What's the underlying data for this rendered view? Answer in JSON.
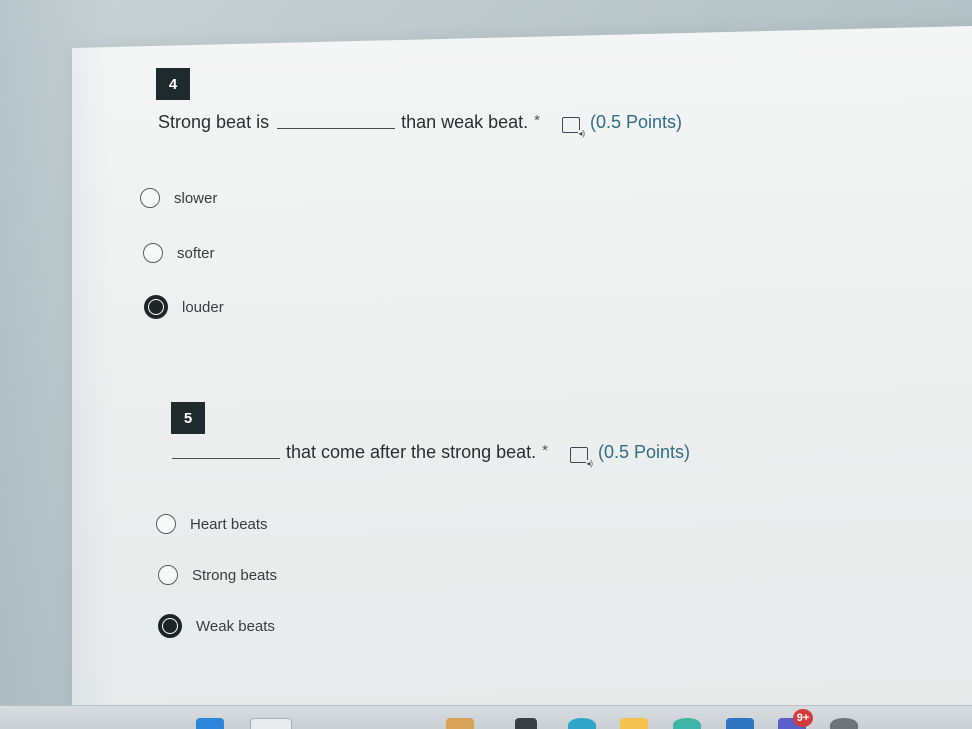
{
  "questions": [
    {
      "number": "4",
      "text_before": "Strong beat is",
      "text_after": "than weak beat.",
      "required_mark": "*",
      "points": "(0.5 Points)",
      "options": [
        {
          "label": "slower",
          "selected": false
        },
        {
          "label": "softer",
          "selected": false
        },
        {
          "label": "louder",
          "selected": true
        }
      ]
    },
    {
      "number": "5",
      "text_after": "that come after the strong beat.",
      "required_mark": "*",
      "points": "(0.5 Points)",
      "options": [
        {
          "label": "Heart beats",
          "selected": false
        },
        {
          "label": "Strong beats",
          "selected": false
        },
        {
          "label": "Weak beats",
          "selected": true
        }
      ]
    }
  ],
  "taskbar": {
    "notification_badge": "9+",
    "icons": [
      "start-icon",
      "search-icon",
      "widgets-icon",
      "task-view-icon",
      "edge-icon",
      "file-explorer-icon",
      "browser-icon",
      "store-icon",
      "teams-icon",
      "settings-icon"
    ]
  }
}
